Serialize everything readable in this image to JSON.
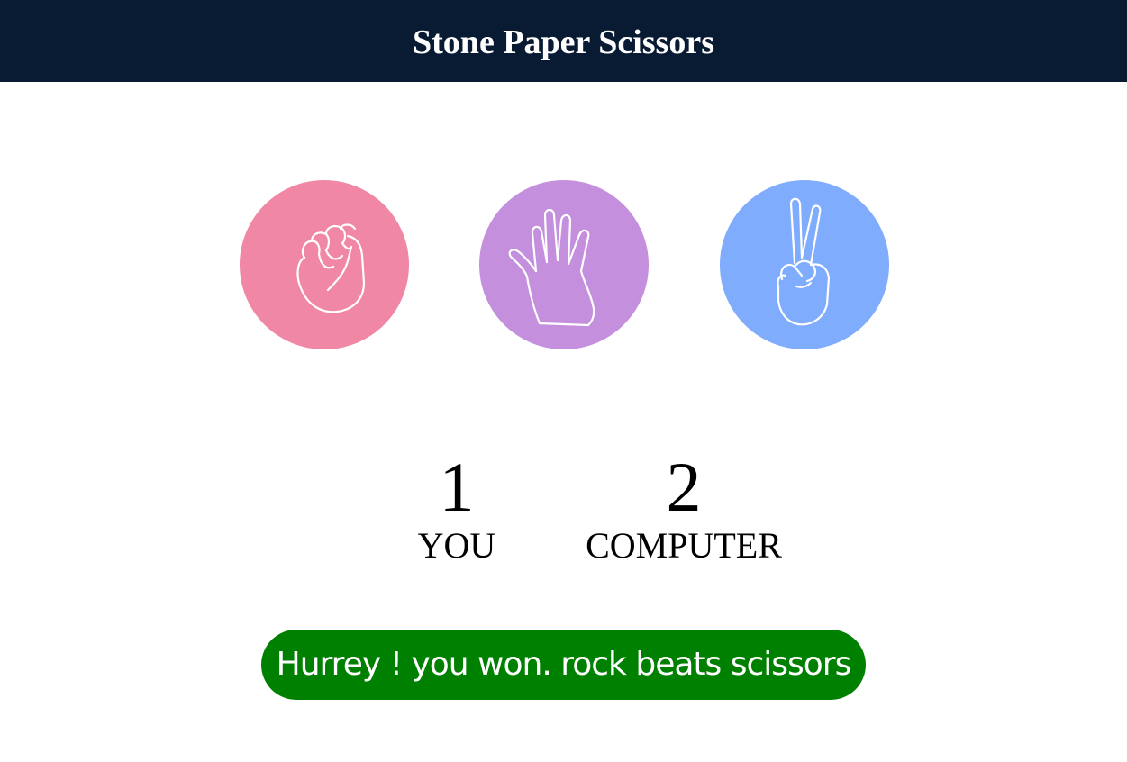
{
  "header": {
    "title": "Stone Paper Scissors",
    "background": "#081b33"
  },
  "choices": [
    {
      "id": "rock",
      "icon": "fist-icon",
      "color": "#f088a5"
    },
    {
      "id": "paper",
      "icon": "open-hand-icon",
      "color": "#c48fdd"
    },
    {
      "id": "scissors",
      "icon": "peace-sign-icon",
      "color": "#80acfd"
    }
  ],
  "scoreboard": {
    "user": {
      "score": "1",
      "label": "YOU"
    },
    "computer": {
      "score": "2",
      "label": "COMPUTER"
    }
  },
  "message": {
    "text": "Hurrey ! you won. rock beats scissors",
    "color": "#008000"
  }
}
